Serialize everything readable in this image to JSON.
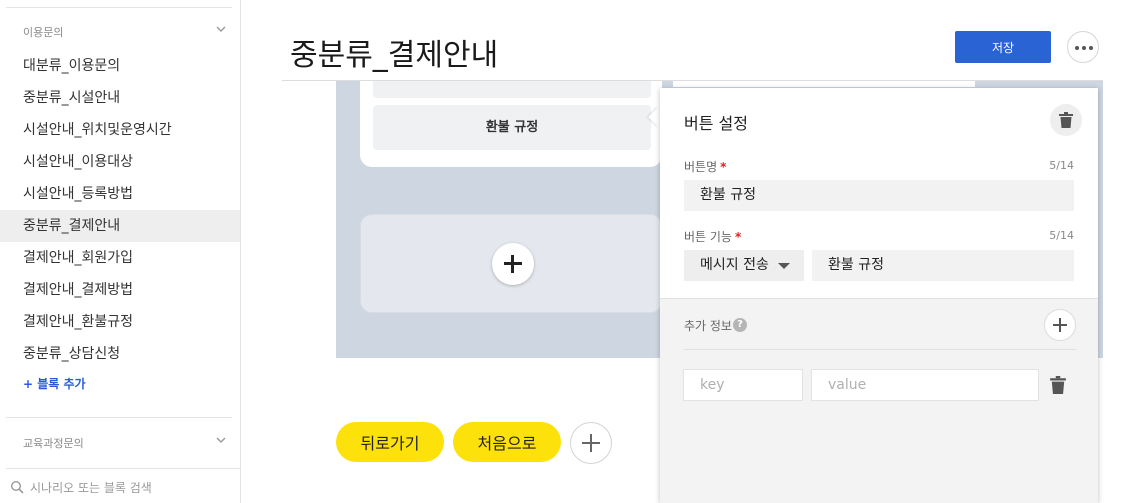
{
  "sidebar": {
    "group1_title": "이용문의",
    "items": [
      {
        "label": "대분류_이용문의"
      },
      {
        "label": "중분류_시설안내"
      },
      {
        "label": "시설안내_위치및운영시간"
      },
      {
        "label": "시설안내_이용대상"
      },
      {
        "label": "시설안내_등록방법"
      },
      {
        "label": "중분류_결제안내",
        "active": true
      },
      {
        "label": "결제안내_회원가입"
      },
      {
        "label": "결제안내_결제방법"
      },
      {
        "label": "결제안내_환불규정"
      },
      {
        "label": "중분류_상담신청"
      }
    ],
    "add_block_label": "+ 블록 추가",
    "group2_title": "교육과정문의",
    "search_placeholder": "시나리오 또는 블록 검색"
  },
  "header": {
    "title": "중분류_결제안내",
    "save_label": "저장"
  },
  "canvas": {
    "card_button_label": "환불 규정"
  },
  "quick_replies": [
    {
      "label": "뒤로가기"
    },
    {
      "label": "처음으로"
    }
  ],
  "button_panel": {
    "title": "버튼 설정",
    "name_label": "버튼명",
    "name_count": "5/14",
    "name_value": "환불 규정",
    "function_label": "버튼 기능",
    "function_count": "5/14",
    "function_select": "메시지 전송",
    "function_value": "환불 규정",
    "extra_title": "추가 정보",
    "help_glyph": "?",
    "key_placeholder": "key",
    "value_placeholder": "value"
  },
  "colors": {
    "primary": "#2a63d4",
    "quick_reply": "#fde10a",
    "canvas_bg": "#cdd6e1",
    "required": "#e02020"
  },
  "icons": [
    "chevron-down-icon",
    "search-icon",
    "more-icon",
    "plus-icon",
    "trash-icon",
    "help-icon",
    "caret-down-icon"
  ]
}
